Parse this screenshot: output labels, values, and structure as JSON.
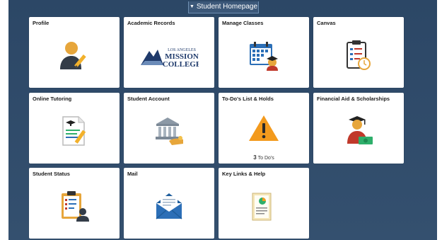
{
  "header": {
    "title": "Student Homepage"
  },
  "tiles": [
    {
      "title": "Profile",
      "icon": "profile-user-icon"
    },
    {
      "title": "Academic Records",
      "icon": "college-logo",
      "logo": {
        "line1": "LOS ANGELES",
        "line2": "MISSION",
        "line3": "COLLEGE"
      }
    },
    {
      "title": "Manage Classes",
      "icon": "calendar-student-icon"
    },
    {
      "title": "Canvas",
      "icon": "clipboard-clock-icon"
    },
    {
      "title": "Online Tutoring",
      "icon": "document-graduation-icon"
    },
    {
      "title": "Student Account",
      "icon": "bank-hand-icon"
    },
    {
      "title": "To-Do's List & Holds",
      "icon": "warning-icon",
      "count": "3",
      "count_label": "To Do's"
    },
    {
      "title": "Financial Aid & Scholarships",
      "icon": "graduate-money-icon"
    },
    {
      "title": "Student Status",
      "icon": "clipboard-person-icon"
    },
    {
      "title": "Mail",
      "icon": "envelope-icon"
    },
    {
      "title": "Key Links & Help",
      "icon": "document-chart-icon"
    }
  ],
  "colors": {
    "background": "#2f4a68",
    "accent_blue": "#2c6fb7",
    "warning": "#f39a1d"
  }
}
